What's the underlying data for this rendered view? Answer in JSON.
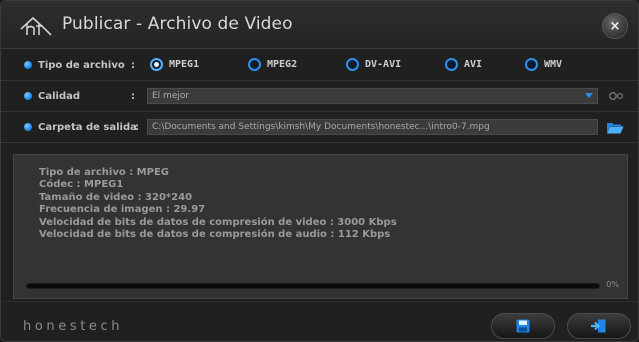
{
  "window": {
    "title": "Publicar - Archivo de Video",
    "close_label": "×"
  },
  "file_type": {
    "label": "Tipo de archivo",
    "colon": ":",
    "options": [
      "MPEG1",
      "MPEG2",
      "DV-AVI",
      "AVI",
      "WMV"
    ],
    "selected": "MPEG1"
  },
  "quality": {
    "label": "Calidad",
    "colon": ":",
    "value": "El mejor"
  },
  "output_folder": {
    "label": "Carpeta de salida",
    "colon": ":",
    "value": "C:\\Documents and Settings\\kimsh\\My Documents\\honestec...\\intro0-7.mpg"
  },
  "info": {
    "lines": [
      "Tipo de archivo : MPEG",
      "Códec : MPEG1",
      "Tamaño de video : 320*240",
      "Frecuencia de imagen : 29.97",
      "Velocidad de bits de datos de compresión de video : 3000 Kbps",
      "Velocidad de bits de datos de compresión de audio : 112 Kbps"
    ]
  },
  "progress": {
    "percent": 0,
    "text": "0%"
  },
  "footer": {
    "brand": "honestech"
  },
  "icons": {
    "logo": "ht-logo-icon",
    "close": "close-icon",
    "settings": "gear-icon",
    "folder": "folder-open-icon",
    "save": "save-icon",
    "exit": "exit-icon"
  },
  "colors": {
    "accent": "#2e8ff0",
    "background": "#202020",
    "panel": "#333333"
  }
}
